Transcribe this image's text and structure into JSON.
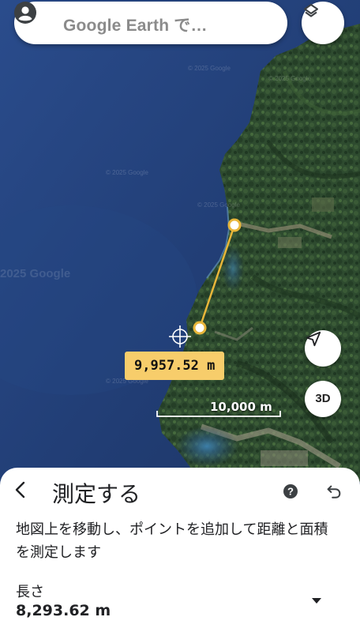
{
  "search": {
    "placeholder": "Google Earth で…",
    "search_icon": "search-icon",
    "account_icon": "account-circle-icon"
  },
  "map": {
    "layers_icon": "layers-icon",
    "measurement_label": "9,957.52 m",
    "scale_label": "10,000 m",
    "nav_icon": "navigation-arrow-icon",
    "threed_label": "3D",
    "watermarks": [
      "© 2025 Google",
      "© 2025 Google",
      "© 2025 Google",
      "2025 Google",
      "© 2025 Google",
      "© 2025 Google"
    ],
    "colors": {
      "ocean": "#213d74",
      "land": "#2b4a2e",
      "measure_line": "#e8b63a"
    }
  },
  "sheet": {
    "back_icon": "chevron-left-icon",
    "title": "測定する",
    "help_icon": "help-circle-icon",
    "undo_icon": "undo-icon",
    "description": "地図上を移動し、ポイントを追加して距離と面積を測定します",
    "length_label": "長さ",
    "length_value": "8,293.62 m",
    "dropdown_icon": "dropdown-arrow-icon"
  }
}
